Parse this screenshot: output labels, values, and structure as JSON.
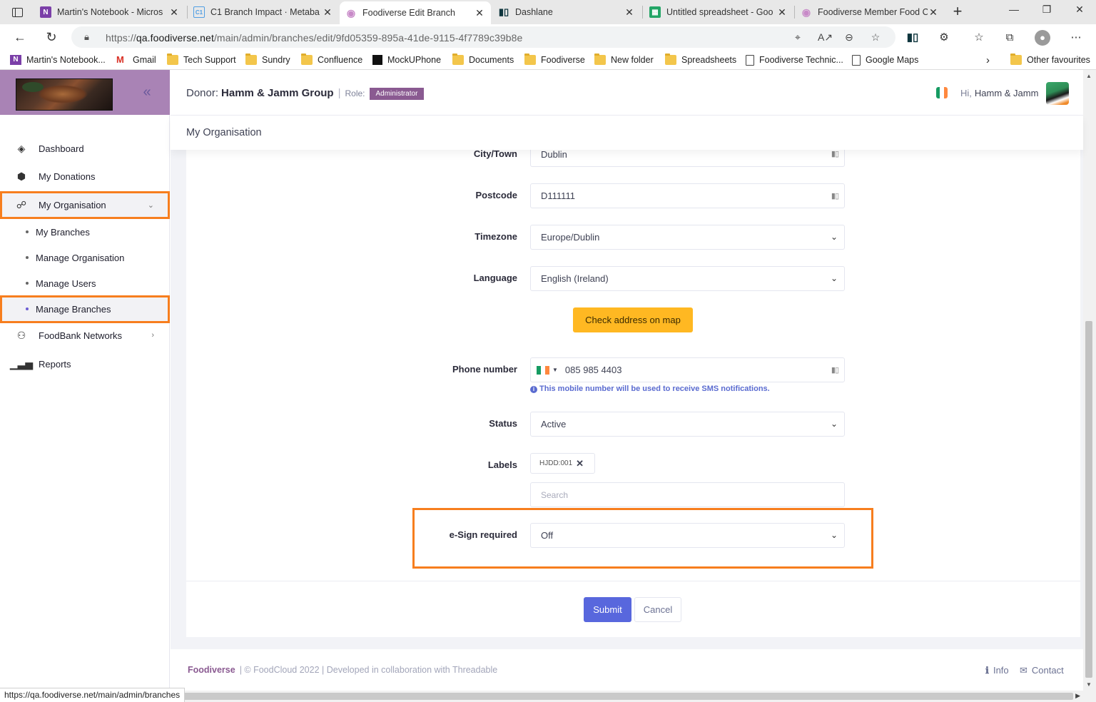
{
  "browser": {
    "tabs": [
      {
        "title": "Martin's Notebook - Micros",
        "favicon": "onenote-icon",
        "color": "#7b3fa8"
      },
      {
        "title": "C1 Branch Impact · Metaba",
        "favicon": "metabase-icon",
        "color": "#509ee3"
      },
      {
        "title": "Foodiverse Edit Branch",
        "favicon": "foodiverse-icon",
        "color": "#c88ac8",
        "active": true
      },
      {
        "title": "Dashlane",
        "favicon": "dashlane-icon",
        "color": "#0e353d"
      },
      {
        "title": "Untitled spreadsheet - Goo",
        "favicon": "sheets-icon",
        "color": "#23a566"
      },
      {
        "title": "Foodiverse Member Food C",
        "favicon": "foodiverse-icon",
        "color": "#c88ac8"
      }
    ],
    "url_prefix": "https://",
    "url_host": "qa.foodiverse.net",
    "url_path": "/main/admin/branches/edit/9fd05359-895a-41de-9115-4f7789c39b8e",
    "bookmarks": [
      {
        "label": "Martin's Notebook...",
        "icon": "onenote-icon"
      },
      {
        "label": "Gmail",
        "icon": "gmail-icon"
      },
      {
        "label": "Tech Support",
        "icon": "folder-icon"
      },
      {
        "label": "Sundry",
        "icon": "folder-icon"
      },
      {
        "label": "Confluence",
        "icon": "folder-icon"
      },
      {
        "label": "MockUPhone",
        "icon": "mockuphone-icon"
      },
      {
        "label": "Documents",
        "icon": "folder-icon"
      },
      {
        "label": "Foodiverse",
        "icon": "folder-icon"
      },
      {
        "label": "New folder",
        "icon": "folder-icon"
      },
      {
        "label": "Spreadsheets",
        "icon": "folder-icon"
      },
      {
        "label": "Foodiverse Technic...",
        "icon": "page-icon"
      },
      {
        "label": "Google Maps",
        "icon": "page-icon"
      }
    ],
    "other_favourites": "Other favourites",
    "status_url": "https://qa.foodiverse.net/main/admin/branches"
  },
  "sidebar": {
    "menu": [
      {
        "label": "Dashboard",
        "icon": "layers-icon"
      },
      {
        "label": "My Donations",
        "icon": "box-icon"
      },
      {
        "label": "My Organisation",
        "icon": "org-chart-icon",
        "expanded": true
      }
    ],
    "submenu": [
      {
        "label": "My Branches"
      },
      {
        "label": "Manage Organisation"
      },
      {
        "label": "Manage Users"
      },
      {
        "label": "Manage Branches",
        "active": true
      }
    ],
    "menu_after": [
      {
        "label": "FoodBank Networks",
        "icon": "network-icon"
      },
      {
        "label": "Reports",
        "icon": "bar-chart-icon"
      }
    ]
  },
  "header": {
    "donor_label": "Donor:",
    "donor_name": "Hamm & Jamm Group",
    "role_label": "Role:",
    "role": "Administrator",
    "greeting": "Hi,",
    "user": "Hamm & Jamm"
  },
  "page_title": "My Organisation",
  "form": {
    "city_label": "City/Town",
    "city_value": "Dublin",
    "postcode_label": "Postcode",
    "postcode_value": "D111111",
    "timezone_label": "Timezone",
    "timezone_value": "Europe/Dublin",
    "language_label": "Language",
    "language_value": "English (Ireland)",
    "map_button": "Check address on map",
    "phone_label": "Phone number",
    "phone_value": "085 985 4403",
    "phone_hint": "This mobile number will be used to receive SMS notifications.",
    "status_label": "Status",
    "status_value": "Active",
    "labels_label": "Labels",
    "label_tag": "HJDD:001",
    "labels_search_placeholder": "Search",
    "esign_label": "e-Sign required",
    "esign_value": "Off",
    "submit": "Submit",
    "cancel": "Cancel"
  },
  "footer": {
    "brand": "Foodiverse",
    "copyright": "|  © FoodCloud 2022  |  Developed in collaboration with Threadable",
    "info": "Info",
    "contact": "Contact"
  },
  "colors": {
    "brand_purple": "#a983b5",
    "highlight_orange": "#f77e1e",
    "primary_button": "#5867dd",
    "warning_button": "#ffb822"
  }
}
